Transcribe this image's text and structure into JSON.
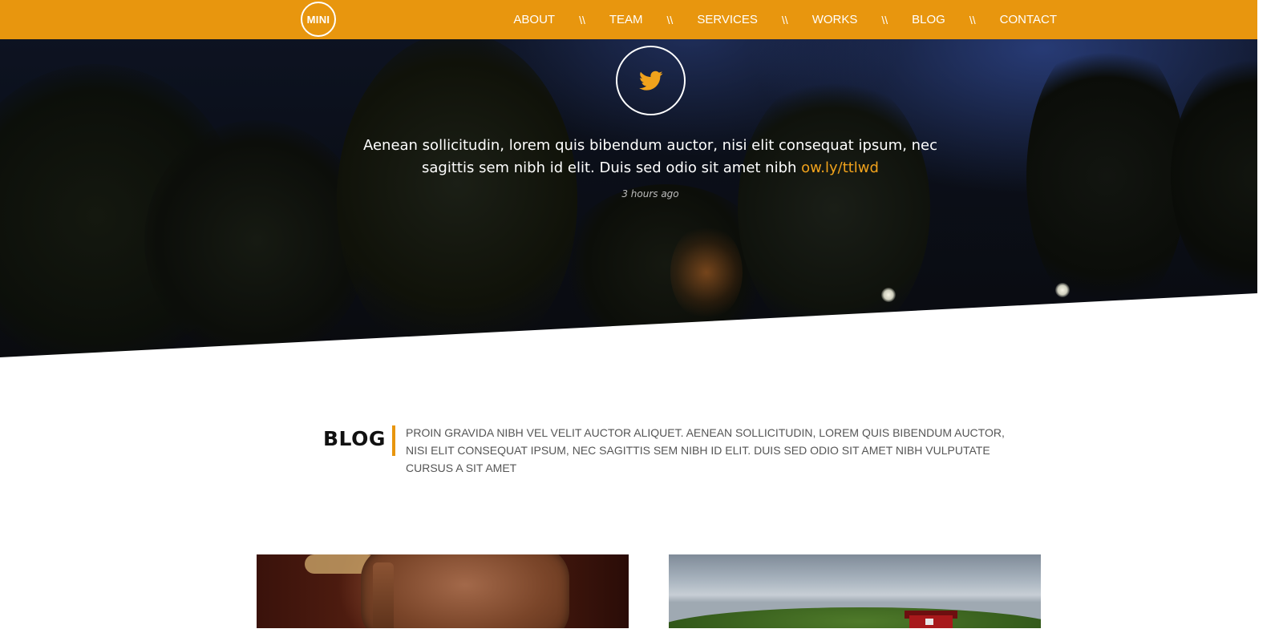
{
  "header": {
    "logo_text": "MINI",
    "nav": [
      {
        "label": "ABOUT"
      },
      {
        "label": "TEAM"
      },
      {
        "label": "SERVICES"
      },
      {
        "label": "WORKS"
      },
      {
        "label": "BLOG"
      },
      {
        "label": "CONTACT"
      }
    ],
    "separator": "\\\\",
    "background_color": "#e8960e"
  },
  "tweet": {
    "icon": "twitter-bird-icon",
    "text": "Aenean sollicitudin, lorem quis bibendum auctor, nisi elit consequat ipsum, nec sagittis sem nibh id elit. Duis sed odio sit amet nibh",
    "link_text": "ow.ly/ttlwd",
    "time": "3 hours ago",
    "accent_color": "#f0a21c"
  },
  "blog": {
    "title": "BLOG",
    "description": "PROIN GRAVIDA NIBH VEL VELIT AUCTOR ALIQUET. AENEAN SOLLICITUDIN, LOREM QUIS BIBENDUM AUCTOR, NISI ELIT CONSEQUAT IPSUM, NEC SAGITTIS SEM NIBH ID ELIT. DUIS SED ODIO SIT AMET NIBH VULPUTATE CURSUS A SIT AMET",
    "posts": [
      {
        "image": "saddle-photo"
      },
      {
        "image": "barn-photo"
      }
    ]
  }
}
